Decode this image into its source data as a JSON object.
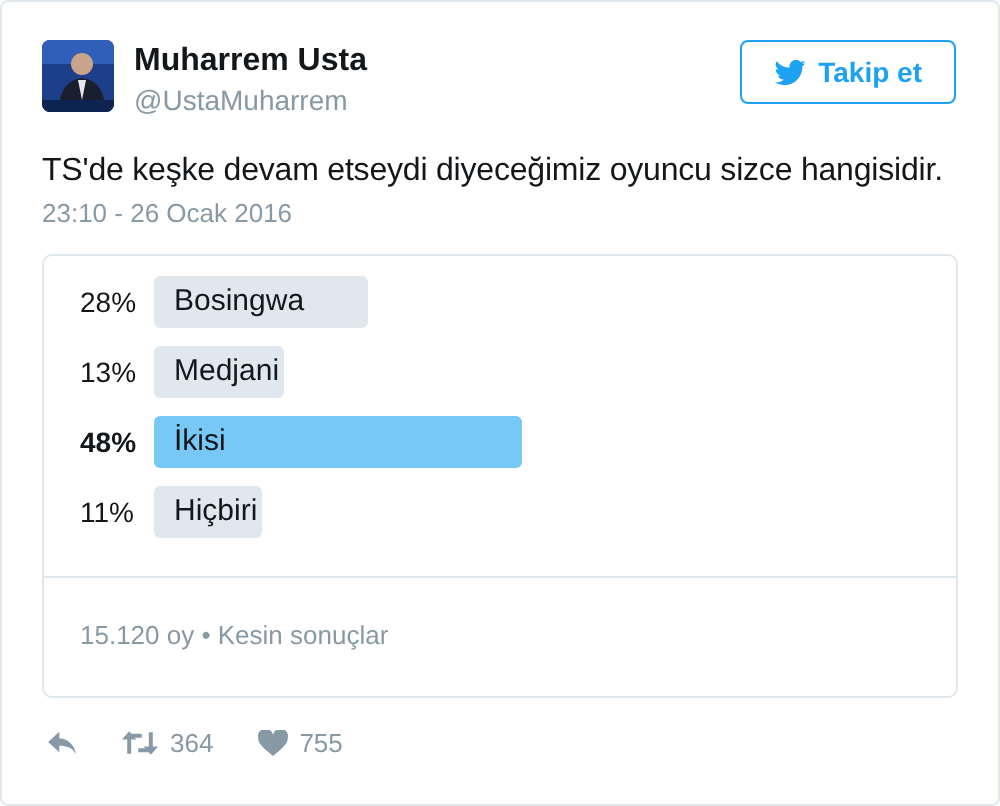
{
  "author": {
    "name": "Muharrem Usta",
    "handle": "@UstaMuharrem"
  },
  "follow_button": {
    "label": "Takip et"
  },
  "tweet": {
    "text": "TS'de keşke devam etseydi diyeceğimiz oyuncu sizce hangisidir.",
    "timestamp": "23:10 - 26 Ocak 2016"
  },
  "poll": {
    "options": [
      {
        "percent": "28%",
        "label": "Bosingwa",
        "selected": false
      },
      {
        "percent": "13%",
        "label": "Medjani",
        "selected": false
      },
      {
        "percent": "48%",
        "label": "İkisi",
        "selected": true
      },
      {
        "percent": "11%",
        "label": "Hiçbiri",
        "selected": false
      }
    ],
    "summary": "15.120 oy • Kesin sonuçlar"
  },
  "actions": {
    "retweets": "364",
    "likes": "755"
  }
}
